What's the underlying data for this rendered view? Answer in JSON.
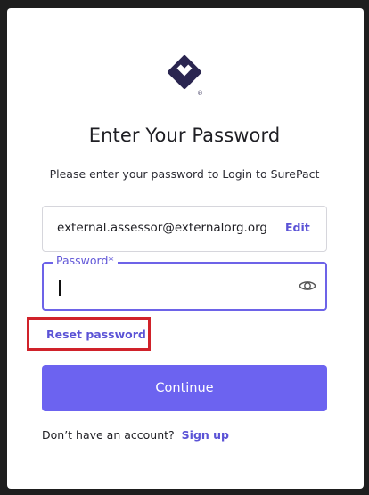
{
  "logo": {
    "icon": "surepact-logo-icon",
    "mark": "®",
    "color": "#2a2550"
  },
  "title": "Enter Your Password",
  "subtitle": "Please enter your password to Login to SurePact",
  "email": {
    "value": "external.assessor@externalorg.org",
    "edit_label": "Edit"
  },
  "password": {
    "label": "Password*",
    "value": "",
    "toggle_icon": "eye-icon"
  },
  "reset_label": "Reset password",
  "continue_label": "Continue",
  "signup": {
    "prompt": "Don’t have an account?",
    "link_label": "Sign up"
  },
  "colors": {
    "accent": "#6c63f0",
    "link": "#5b53d6",
    "highlight": "#d0222a"
  }
}
